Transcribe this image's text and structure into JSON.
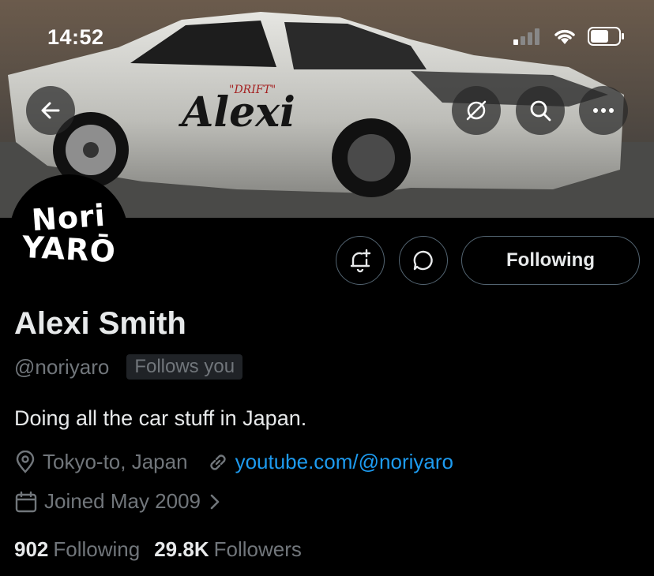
{
  "status_bar": {
    "time": "14:52",
    "icons": [
      "cellular-signal-icon",
      "wifi-icon",
      "battery-icon"
    ]
  },
  "banner": {
    "car_lettering": "Alexi",
    "car_badge": "\"DRIFT\""
  },
  "header_actions": [
    "back-arrow-icon",
    "grok-icon",
    "search-icon",
    "more-icon"
  ],
  "avatar": {
    "line1": "Nori",
    "line2": "YARŌ"
  },
  "actions": {
    "notify_icon": "bell-plus-icon",
    "message_icon": "message-icon",
    "follow_label": "Following"
  },
  "profile": {
    "name": "Alexi Smith",
    "handle": "@noriyaro",
    "follows_you": "Follows you",
    "bio": "Doing all the car stuff in Japan.",
    "location": "Tokyo-to, Japan",
    "website": "youtube.com/@noriyaro",
    "joined": "Joined May 2009"
  },
  "stats": {
    "following_count": "902",
    "following_label": "Following",
    "followers_count": "29.8K",
    "followers_label": "Followers"
  },
  "colors": {
    "background": "#000000",
    "text_primary": "#e7e9ea",
    "text_secondary": "#71767b",
    "link": "#1d9bf0",
    "border": "#536471"
  }
}
